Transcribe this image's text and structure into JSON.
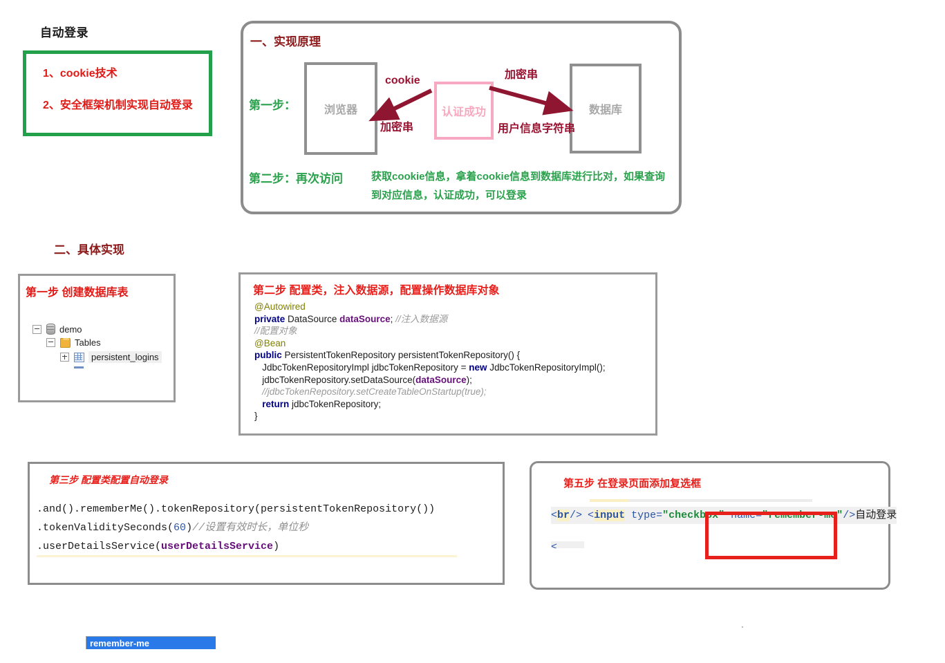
{
  "page": {
    "title": "自动登录"
  },
  "intro_box": {
    "items": [
      "1、cookie技术",
      "2、安全框架机制实现自动登录"
    ],
    "border_color": "#22a14a",
    "text_color": "#e01b17"
  },
  "principle": {
    "title": "一、实现原理",
    "title_color": "#8c1a1a",
    "nodes": {
      "browser": "浏览器",
      "auth": "认证成功",
      "database": "数据库"
    },
    "arrow_labels": {
      "cookie": "cookie",
      "encrypted_left": "加密串",
      "encrypted_right": "加密串",
      "user_info": "用户信息字符串"
    },
    "steps": {
      "step1": "第一步：",
      "step2": "第二步：再次访问",
      "step2_text": "获取cookie信息，拿着cookie信息到数据库进行比对，如果查询到对应信息，认证成功，可以登录"
    },
    "colors": {
      "step": "#2aa14c",
      "arrow": "#9b1231",
      "auth_box": "#f6a9c0",
      "node_border": "#909090"
    }
  },
  "section2": {
    "title": "二、具体实现",
    "title_color": "#8c1a1a"
  },
  "step1": {
    "title": "第一步 创建数据库表",
    "title_color": "#e01b17",
    "tree": [
      {
        "label": "demo",
        "icon": "database-icon",
        "expander": "minus",
        "selected": false
      },
      {
        "label": "Tables",
        "icon": "folder-icon",
        "expander": "minus",
        "selected": false
      },
      {
        "label": "persistent_logins",
        "icon": "table-grid-icon",
        "expander": "plus",
        "selected": true
      }
    ]
  },
  "step2": {
    "title": "第二步 配置类，注入数据源，配置操作数据库对象",
    "title_color": "#e8201c",
    "code_lines": [
      [
        {
          "t": "@Autowired",
          "c": "ann"
        }
      ],
      [
        {
          "t": "private ",
          "c": "kw"
        },
        {
          "t": "DataSource ",
          "c": "txt"
        },
        {
          "t": "dataSource",
          "c": "fld"
        },
        {
          "t": "; ",
          "c": "txt"
        },
        {
          "t": "//注入数据源",
          "c": "cmt"
        }
      ],
      [
        {
          "t": "//配置对象",
          "c": "cmt"
        }
      ],
      [
        {
          "t": "@Bean",
          "c": "ann"
        }
      ],
      [
        {
          "t": "public ",
          "c": "kw"
        },
        {
          "t": "PersistentTokenRepository persistentTokenRepository() {",
          "c": "txt"
        }
      ],
      [
        {
          "t": "   JdbcTokenRepositoryImpl jdbcTokenRepository = ",
          "c": "txt"
        },
        {
          "t": "new ",
          "c": "kw"
        },
        {
          "t": "JdbcTokenRepositoryImpl();",
          "c": "txt"
        }
      ],
      [
        {
          "t": "   jdbcTokenRepository.setDataSource(",
          "c": "txt"
        },
        {
          "t": "dataSource",
          "c": "fld"
        },
        {
          "t": ");",
          "c": "txt"
        }
      ],
      [
        {
          "t": "   //jdbcTokenRepository.setCreateTableOnStartup(true);",
          "c": "cmt"
        }
      ],
      [
        {
          "t": "   return ",
          "c": "kw"
        },
        {
          "t": "jdbcTokenRepository;",
          "c": "txt"
        }
      ],
      [
        {
          "t": "}",
          "c": "txt"
        }
      ]
    ]
  },
  "step3": {
    "title": "第三步 配置类配置自动登录",
    "title_color": "#e8201c",
    "code_lines": [
      [
        {
          "t": ".and().rememberMe().tokenRepository(persistentTokenRepository())",
          "c": "plain"
        }
      ],
      [
        {
          "t": ".tokenValiditySeconds(",
          "c": "plain"
        },
        {
          "t": "60",
          "c": "num"
        },
        {
          "t": ")",
          "c": "plain"
        },
        {
          "t": "//设置有效时长，单位秒",
          "c": "cmt"
        }
      ],
      [
        {
          "t": ".userDetailsService(",
          "c": "plain"
        },
        {
          "t": "userDetailsService",
          "c": "pur"
        },
        {
          "t": ")",
          "c": "plain"
        }
      ]
    ]
  },
  "step5": {
    "title": "第五步 在登录页面添加复选框",
    "title_color": "#e8201c",
    "code_lines": [
      [
        {
          "t": "<",
          "c": "ang"
        },
        {
          "t": "br",
          "c": "tag"
        },
        {
          "t": "/>",
          "c": "ang"
        }
      ],
      [
        {
          "t": "<",
          "c": "ang"
        },
        {
          "t": "input",
          "c": "tag"
        },
        {
          "t": " ",
          "c": "plain"
        },
        {
          "t": "type=",
          "c": "attr"
        },
        {
          "t": "\"checkbox\"",
          "c": "val"
        },
        {
          "t": " ",
          "c": "plain"
        },
        {
          "t": "name=",
          "c": "attr"
        },
        {
          "t": "\"remember-me\"",
          "c": "val"
        },
        {
          "t": "/>",
          "c": "ang"
        },
        {
          "t": "自动登录",
          "c": "plain"
        }
      ]
    ],
    "highlight_color": "#e8201c"
  },
  "bottom_field": {
    "value": "remember-me",
    "background": "#2979e8",
    "text_color": "#ffffff"
  }
}
